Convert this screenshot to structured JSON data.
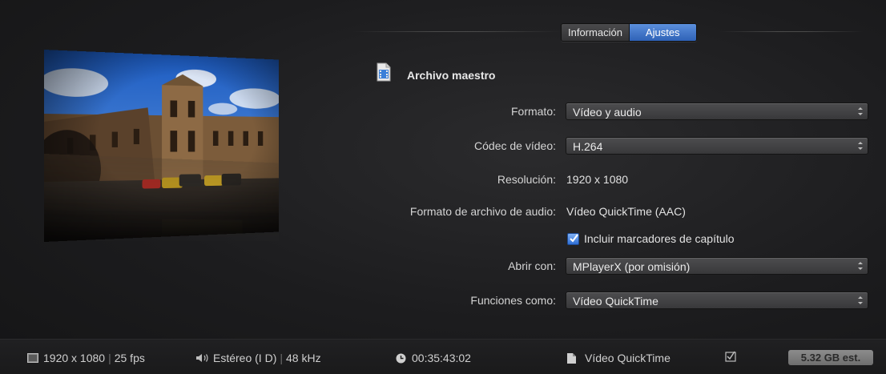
{
  "tabs": [
    {
      "label": "Información",
      "active": false
    },
    {
      "label": "Ajustes",
      "active": true
    }
  ],
  "section": {
    "title": "Archivo maestro",
    "icon": "document-film-icon"
  },
  "settings": {
    "formato": {
      "label": "Formato:",
      "value": "Vídeo y audio"
    },
    "codec": {
      "label": "Códec de vídeo:",
      "value": "H.264"
    },
    "resolucion": {
      "label": "Resolución:",
      "value": "1920 x 1080"
    },
    "audio": {
      "label": "Formato de archivo de audio:",
      "value": "Vídeo QuickTime (AAC)"
    },
    "marcadores": {
      "label": "Incluir marcadores de capítulo",
      "checked": true
    },
    "abrir": {
      "label": "Abrir con:",
      "value": "MPlayerX (por omisión)"
    },
    "funciones": {
      "label": "Funciones como:",
      "value": "Vídeo QuickTime"
    }
  },
  "footer": {
    "resolution": "1920 x 1080",
    "fps": "25 fps",
    "audio_channels": "Estéreo (I D)",
    "sample_rate": "48 kHz",
    "duration": "00:35:43:02",
    "format": "Vídeo QuickTime",
    "size": "5.32 GB est."
  },
  "colors": {
    "accent": "#2f62b7",
    "background": "#1c1c1e"
  }
}
